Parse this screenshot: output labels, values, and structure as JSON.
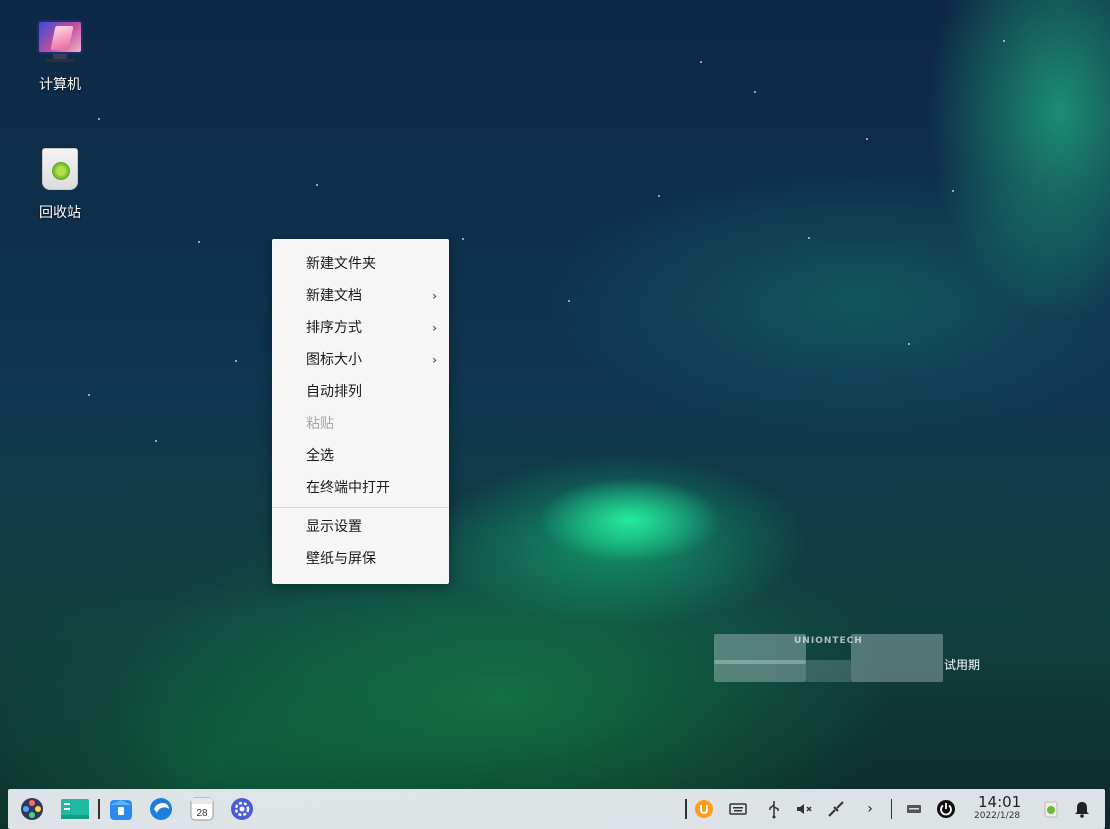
{
  "desktop": {
    "icons": [
      {
        "label": "计算机",
        "icon": "computer-icon"
      },
      {
        "label": "回收站",
        "icon": "trash-icon"
      }
    ]
  },
  "context_menu": {
    "groups": [
      [
        {
          "label": "新建文件夹",
          "submenu": false,
          "disabled": false
        },
        {
          "label": "新建文档",
          "submenu": true,
          "disabled": false
        },
        {
          "label": "排序方式",
          "submenu": true,
          "disabled": false
        },
        {
          "label": "图标大小",
          "submenu": true,
          "disabled": false
        },
        {
          "label": "自动排列",
          "submenu": false,
          "disabled": false
        },
        {
          "label": "粘贴",
          "submenu": false,
          "disabled": true
        },
        {
          "label": "全选",
          "submenu": false,
          "disabled": false
        },
        {
          "label": "在终端中打开",
          "submenu": false,
          "disabled": false
        }
      ],
      [
        {
          "label": "显示设置",
          "submenu": false,
          "disabled": false
        },
        {
          "label": "壁纸与屏保",
          "submenu": false,
          "disabled": false
        }
      ]
    ],
    "submenu_glyph": "›"
  },
  "watermark": {
    "brand": "UNIONTECH",
    "trial_label": "试用期"
  },
  "taskbar": {
    "apps": [
      "launcher-icon",
      "multitask-view-icon",
      "app-store-icon",
      "browser-icon",
      "calendar-icon",
      "settings-icon"
    ],
    "calendar_day": "28",
    "tray": [
      "uos-ai-icon",
      "keyboard-icon",
      "usb-icon",
      "volume-muted-icon",
      "wired-network-icon",
      "expand-tray-icon",
      "keyboard-layout-icon",
      "power-icon"
    ],
    "expand_glyph": "›",
    "clock": {
      "time": "14:01",
      "date": "2022/1/28"
    },
    "notification_icon": "bell-icon"
  },
  "colors": {
    "accent_blue": "#1e6fd9",
    "menu_bg": "#f6f6f6",
    "taskbar_bg": "#eef0f4"
  }
}
